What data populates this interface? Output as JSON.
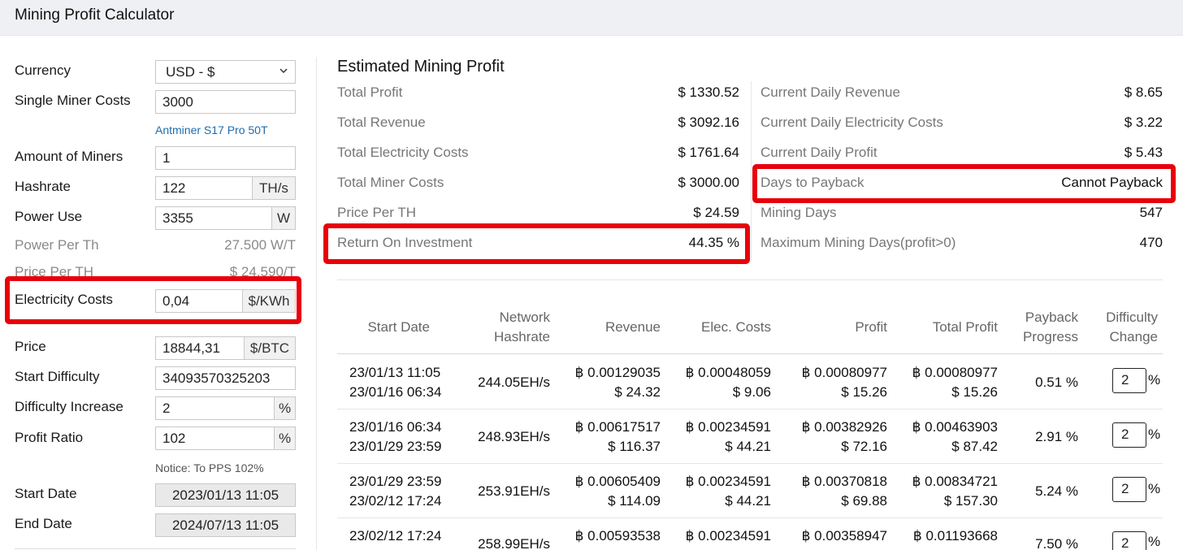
{
  "app": {
    "title": "Mining Profit Calculator"
  },
  "form": {
    "currency": {
      "label": "Currency",
      "value": "USD - $"
    },
    "miner_cost": {
      "label": "Single Miner Costs",
      "value": "3000",
      "link": "Antminer S17 Pro 50T"
    },
    "amount": {
      "label": "Amount of Miners",
      "value": "1"
    },
    "hashrate": {
      "label": "Hashrate",
      "value": "122",
      "unit": "TH/s"
    },
    "power": {
      "label": "Power Use",
      "value": "3355",
      "unit": "W"
    },
    "power_per_th": {
      "label": "Power Per Th",
      "value": "27.500 W/T"
    },
    "price_per_th": {
      "label": "Price Per TH",
      "value": "$ 24.590/T"
    },
    "electricity": {
      "label": "Electricity Costs",
      "value": "0,04",
      "unit": "$/KWh"
    },
    "price": {
      "label": "Price",
      "value": "18844,31",
      "unit": "$/BTC"
    },
    "start_difficulty": {
      "label": "Start Difficulty",
      "value": "34093570325203"
    },
    "difficulty_increase": {
      "label": "Difficulty Increase",
      "value": "2",
      "unit": "%"
    },
    "profit_ratio": {
      "label": "Profit Ratio",
      "value": "102",
      "unit": "%"
    },
    "notice": "Notice: To PPS 102%",
    "start_date": {
      "label": "Start Date",
      "value": "2023/01/13 11:05"
    },
    "end_date": {
      "label": "End Date",
      "value": "2024/07/13 11:05"
    }
  },
  "summary": {
    "title": "Estimated Mining Profit",
    "left": [
      {
        "label": "Total Profit",
        "value": "$ 1330.52"
      },
      {
        "label": "Total Revenue",
        "value": "$ 3092.16"
      },
      {
        "label": "Total Electricity Costs",
        "value": "$ 1761.64"
      },
      {
        "label": "Total Miner Costs",
        "value": "$ 3000.00"
      },
      {
        "label": "Price Per TH",
        "value": "$ 24.59"
      },
      {
        "label": "Return On Investment",
        "value": "44.35 %"
      }
    ],
    "right": [
      {
        "label": "Current Daily Revenue",
        "value": "$ 8.65"
      },
      {
        "label": "Current Daily Electricity Costs",
        "value": "$ 3.22"
      },
      {
        "label": "Current Daily Profit",
        "value": "$ 5.43"
      },
      {
        "label": "Days to Payback",
        "value": "Cannot Payback"
      },
      {
        "label": "Mining Days",
        "value": "547"
      },
      {
        "label": "Maximum Mining Days(profit>0)",
        "value": "470"
      }
    ]
  },
  "table": {
    "headers": {
      "start_date": "Start Date",
      "network_hashrate_1": "Network",
      "network_hashrate_2": "Hashrate",
      "revenue": "Revenue",
      "elec_costs": "Elec. Costs",
      "profit": "Profit",
      "total_profit": "Total Profit",
      "payback_1": "Payback",
      "payback_2": "Progress",
      "difficulty_1": "Difficulty",
      "difficulty_2": "Change"
    },
    "rows": [
      {
        "start": "23/01/13 11:05",
        "end": "23/01/16 06:34",
        "hashrate": "244.05EH/s",
        "revenue_btc": "฿ 0.00129035",
        "revenue_usd": "$ 24.32",
        "elec_btc": "฿ 0.00048059",
        "elec_usd": "$ 9.06",
        "profit_btc": "฿ 0.00080977",
        "profit_usd": "$ 15.26",
        "total_btc": "฿ 0.00080977",
        "total_usd": "$ 15.26",
        "payback": "0.51 %",
        "difficulty": "2"
      },
      {
        "start": "23/01/16 06:34",
        "end": "23/01/29 23:59",
        "hashrate": "248.93EH/s",
        "revenue_btc": "฿ 0.00617517",
        "revenue_usd": "$ 116.37",
        "elec_btc": "฿ 0.00234591",
        "elec_usd": "$ 44.21",
        "profit_btc": "฿ 0.00382926",
        "profit_usd": "$ 72.16",
        "total_btc": "฿ 0.00463903",
        "total_usd": "$ 87.42",
        "payback": "2.91 %",
        "difficulty": "2"
      },
      {
        "start": "23/01/29 23:59",
        "end": "23/02/12 17:24",
        "hashrate": "253.91EH/s",
        "revenue_btc": "฿ 0.00605409",
        "revenue_usd": "$ 114.09",
        "elec_btc": "฿ 0.00234591",
        "elec_usd": "$ 44.21",
        "profit_btc": "฿ 0.00370818",
        "profit_usd": "$ 69.88",
        "total_btc": "฿ 0.00834721",
        "total_usd": "$ 157.30",
        "payback": "5.24 %",
        "difficulty": "2"
      },
      {
        "start": "23/02/12 17:24",
        "hashrate": "258.99EH/s",
        "revenue_btc": "฿ 0.00593538",
        "elec_btc": "฿ 0.00234591",
        "profit_btc": "฿ 0.00358947",
        "total_btc": "฿ 0.01193668",
        "payback": "7.50 %",
        "difficulty": "2"
      }
    ],
    "percent_sign": "%"
  },
  "colors": {
    "highlight": "#e8000b",
    "link": "#1e6bb0",
    "header_bg": "#eef0f3"
  }
}
